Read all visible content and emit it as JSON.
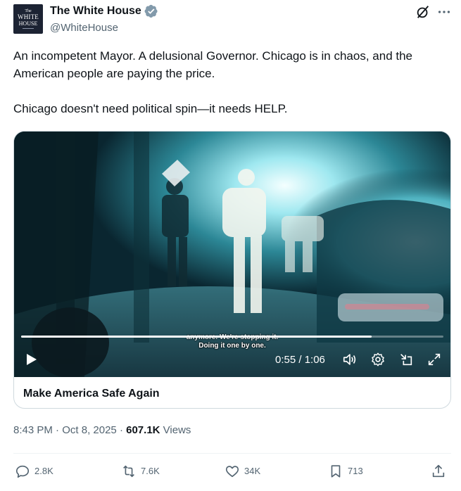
{
  "author": {
    "display_name": "The White House",
    "handle": "@WhiteHouse",
    "verified_icon": "verified-badge-icon",
    "avatar_text": [
      "The",
      "WHITE",
      "HOUSE"
    ]
  },
  "tweet": {
    "paragraphs": [
      "An incompetent Mayor. A delusional Governor. Chicago is in chaos, and the American people are paying the price.",
      "Chicago doesn't need political spin—it needs HELP."
    ]
  },
  "video": {
    "caption_line1": "anymore. We're stopping it.",
    "caption_line2": "Doing it one by one.",
    "time": "0:55 / 1:06",
    "progress_fraction": 0.83,
    "controls": [
      "play-icon",
      "volume-icon",
      "settings-icon",
      "minimize-icon",
      "fullscreen-icon"
    ]
  },
  "card": {
    "title": "Make America Safe Again"
  },
  "meta": {
    "time": "8:43 PM",
    "separator": " · ",
    "date": "Oct 8, 2025",
    "views_count": "607.1K",
    "views_label": " Views"
  },
  "actions": {
    "replies": "2.8K",
    "reposts": "7.6K",
    "likes": "34K",
    "bookmarks": "713"
  },
  "colors": {
    "text": "#0f1419",
    "secondary": "#536471",
    "verified": "#829aab",
    "border": "#cfd9de"
  }
}
